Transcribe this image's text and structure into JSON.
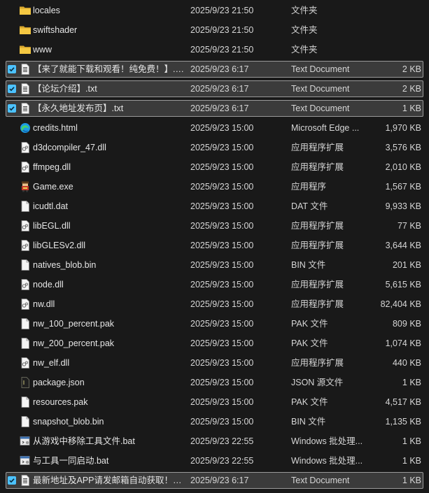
{
  "files": [
    {
      "name": "locales",
      "date": "2025/9/23 21:50",
      "type": "文件夹",
      "size": "",
      "icon": "folder-icon",
      "selected": false
    },
    {
      "name": "swiftshader",
      "date": "2025/9/23 21:50",
      "type": "文件夹",
      "size": "",
      "icon": "folder-icon",
      "selected": false
    },
    {
      "name": "www",
      "date": "2025/9/23 21:50",
      "type": "文件夹",
      "size": "",
      "icon": "folder-icon",
      "selected": false
    },
    {
      "name": "【来了就能下载和观看！纯免费！】.txt",
      "date": "2025/9/23 6:17",
      "type": "Text Document",
      "size": "2 KB",
      "icon": "text-file-icon",
      "selected": true
    },
    {
      "name": "【论坛介绍】.txt",
      "date": "2025/9/23 6:17",
      "type": "Text Document",
      "size": "2 KB",
      "icon": "text-file-icon",
      "selected": true
    },
    {
      "name": "【永久地址发布页】.txt",
      "date": "2025/9/23 6:17",
      "type": "Text Document",
      "size": "1 KB",
      "icon": "text-file-icon",
      "selected": true
    },
    {
      "name": "credits.html",
      "date": "2025/9/23 15:00",
      "type": "Microsoft Edge ...",
      "size": "1,970 KB",
      "icon": "edge-icon",
      "selected": false
    },
    {
      "name": "d3dcompiler_47.dll",
      "date": "2025/9/23 15:00",
      "type": "应用程序扩展",
      "size": "3,576 KB",
      "icon": "dll-file-icon",
      "selected": false
    },
    {
      "name": "ffmpeg.dll",
      "date": "2025/9/23 15:00",
      "type": "应用程序扩展",
      "size": "2,010 KB",
      "icon": "dll-file-icon",
      "selected": false
    },
    {
      "name": "Game.exe",
      "date": "2025/9/23 15:00",
      "type": "应用程序",
      "size": "1,567 KB",
      "icon": "game-exe-icon",
      "selected": false
    },
    {
      "name": "icudtl.dat",
      "date": "2025/9/23 15:00",
      "type": "DAT 文件",
      "size": "9,933 KB",
      "icon": "blank-file-icon",
      "selected": false
    },
    {
      "name": "libEGL.dll",
      "date": "2025/9/23 15:00",
      "type": "应用程序扩展",
      "size": "77 KB",
      "icon": "dll-file-icon",
      "selected": false
    },
    {
      "name": "libGLESv2.dll",
      "date": "2025/9/23 15:00",
      "type": "应用程序扩展",
      "size": "3,644 KB",
      "icon": "dll-file-icon",
      "selected": false
    },
    {
      "name": "natives_blob.bin",
      "date": "2025/9/23 15:00",
      "type": "BIN 文件",
      "size": "201 KB",
      "icon": "blank-file-icon",
      "selected": false
    },
    {
      "name": "node.dll",
      "date": "2025/9/23 15:00",
      "type": "应用程序扩展",
      "size": "5,615 KB",
      "icon": "dll-file-icon",
      "selected": false
    },
    {
      "name": "nw.dll",
      "date": "2025/9/23 15:00",
      "type": "应用程序扩展",
      "size": "82,404 KB",
      "icon": "dll-file-icon",
      "selected": false
    },
    {
      "name": "nw_100_percent.pak",
      "date": "2025/9/23 15:00",
      "type": "PAK 文件",
      "size": "809 KB",
      "icon": "blank-file-icon",
      "selected": false
    },
    {
      "name": "nw_200_percent.pak",
      "date": "2025/9/23 15:00",
      "type": "PAK 文件",
      "size": "1,074 KB",
      "icon": "blank-file-icon",
      "selected": false
    },
    {
      "name": "nw_elf.dll",
      "date": "2025/9/23 15:00",
      "type": "应用程序扩展",
      "size": "440 KB",
      "icon": "dll-file-icon",
      "selected": false
    },
    {
      "name": "package.json",
      "date": "2025/9/23 15:00",
      "type": "JSON 源文件",
      "size": "1 KB",
      "icon": "json-file-icon",
      "selected": false
    },
    {
      "name": "resources.pak",
      "date": "2025/9/23 15:00",
      "type": "PAK 文件",
      "size": "4,517 KB",
      "icon": "blank-file-icon",
      "selected": false
    },
    {
      "name": "snapshot_blob.bin",
      "date": "2025/9/23 15:00",
      "type": "BIN 文件",
      "size": "1,135 KB",
      "icon": "blank-file-icon",
      "selected": false
    },
    {
      "name": "从游戏中移除工具文件.bat",
      "date": "2025/9/23 22:55",
      "type": "Windows 批处理...",
      "size": "1 KB",
      "icon": "batch-file-icon",
      "selected": false
    },
    {
      "name": "与工具一同启动.bat",
      "date": "2025/9/23 22:55",
      "type": "Windows 批处理...",
      "size": "1 KB",
      "icon": "batch-file-icon",
      "selected": false
    },
    {
      "name": "最新地址及APP请发邮箱自动获取！！...",
      "date": "2025/9/23 6:17",
      "type": "Text Document",
      "size": "1 KB",
      "icon": "text-file-icon",
      "selected": true
    }
  ],
  "colors": {
    "background": "#191919",
    "selection": "#3b3b3b",
    "accent": "#4cc2ff",
    "folder": "#f2c94c"
  }
}
